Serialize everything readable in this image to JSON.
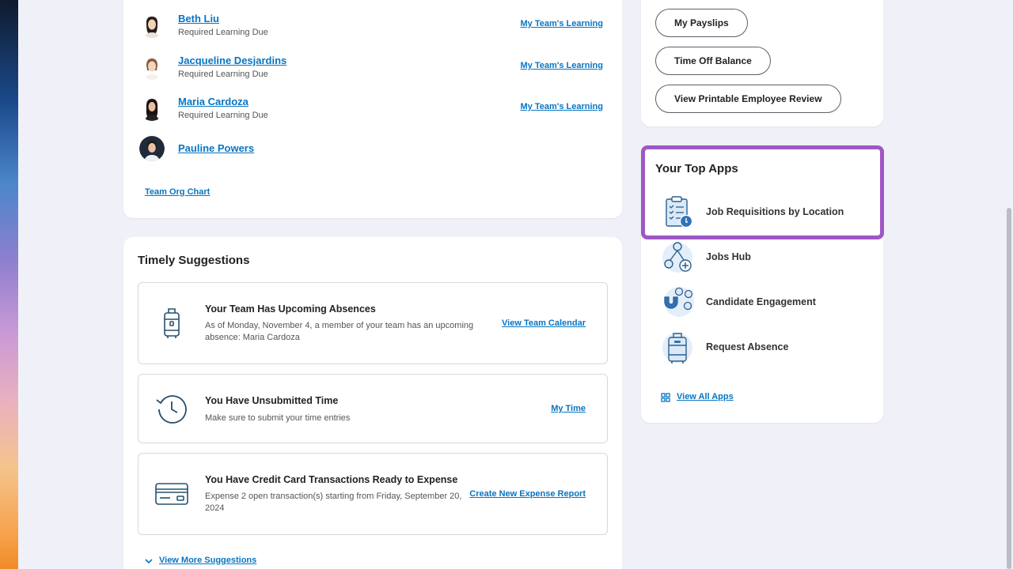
{
  "team": {
    "members": [
      {
        "name": "Beth Liu",
        "status": "Required Learning Due",
        "link": "My Team's Learning"
      },
      {
        "name": "Jacqueline Desjardins",
        "status": "Required Learning Due",
        "link": "My Team's Learning"
      },
      {
        "name": "Maria Cardoza",
        "status": "Required Learning Due",
        "link": "My Team's Learning"
      },
      {
        "name": "Pauline Powers"
      }
    ],
    "org_chart_label": "Team Org Chart"
  },
  "suggestions": {
    "title": "Timely Suggestions",
    "items": [
      {
        "icon": "luggage-icon",
        "title": "Your Team Has Upcoming Absences",
        "body": "As of Monday, November 4, a member of your team has an upcoming absence: Maria Cardoza",
        "link": "View Team Calendar"
      },
      {
        "icon": "clock-history-icon",
        "title": "You Have Unsubmitted Time",
        "body": "Make sure to submit your time entries",
        "link": "My Time"
      },
      {
        "icon": "credit-card-icon",
        "title": "You Have Credit Card Transactions Ready to Expense",
        "body": "Expense 2 open transaction(s) starting from Friday, September 20, 2024",
        "link": "Create New Expense Report"
      }
    ],
    "more_label": "View More Suggestions"
  },
  "quick_actions": {
    "buttons": [
      "My Payslips",
      "Time Off Balance",
      "View Printable Employee Review"
    ]
  },
  "top_apps": {
    "title": "Your Top Apps",
    "apps": [
      {
        "icon": "clipboard-icon",
        "label": "Job Requisitions by Location"
      },
      {
        "icon": "org-network-icon",
        "label": "Jobs Hub"
      },
      {
        "icon": "magnet-people-icon",
        "label": "Candidate Engagement"
      },
      {
        "icon": "luggage-icon",
        "label": "Request Absence"
      }
    ],
    "view_all_label": "View All Apps"
  },
  "colors": {
    "link": "#0875c2",
    "highlight": "#9f57c6",
    "background": "#f0f1f8"
  }
}
